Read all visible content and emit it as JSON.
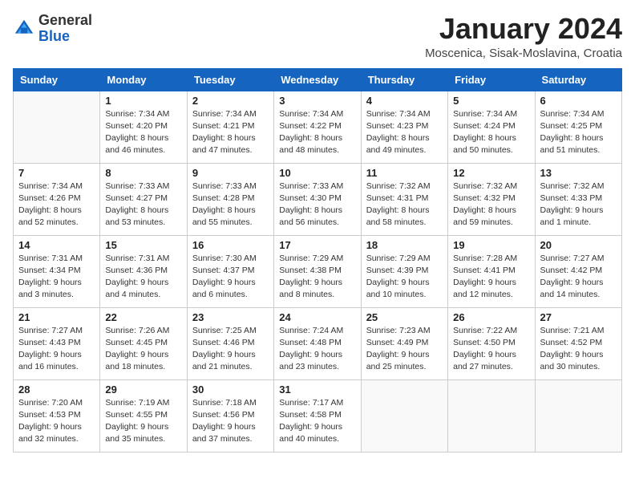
{
  "header": {
    "logo_general": "General",
    "logo_blue": "Blue",
    "month_title": "January 2024",
    "location": "Moscenica, Sisak-Moslavina, Croatia"
  },
  "days_of_week": [
    "Sunday",
    "Monday",
    "Tuesday",
    "Wednesday",
    "Thursday",
    "Friday",
    "Saturday"
  ],
  "weeks": [
    [
      {
        "day": "",
        "sunrise": "",
        "sunset": "",
        "daylight": "",
        "empty": true
      },
      {
        "day": "1",
        "sunrise": "Sunrise: 7:34 AM",
        "sunset": "Sunset: 4:20 PM",
        "daylight": "Daylight: 8 hours and 46 minutes."
      },
      {
        "day": "2",
        "sunrise": "Sunrise: 7:34 AM",
        "sunset": "Sunset: 4:21 PM",
        "daylight": "Daylight: 8 hours and 47 minutes."
      },
      {
        "day": "3",
        "sunrise": "Sunrise: 7:34 AM",
        "sunset": "Sunset: 4:22 PM",
        "daylight": "Daylight: 8 hours and 48 minutes."
      },
      {
        "day": "4",
        "sunrise": "Sunrise: 7:34 AM",
        "sunset": "Sunset: 4:23 PM",
        "daylight": "Daylight: 8 hours and 49 minutes."
      },
      {
        "day": "5",
        "sunrise": "Sunrise: 7:34 AM",
        "sunset": "Sunset: 4:24 PM",
        "daylight": "Daylight: 8 hours and 50 minutes."
      },
      {
        "day": "6",
        "sunrise": "Sunrise: 7:34 AM",
        "sunset": "Sunset: 4:25 PM",
        "daylight": "Daylight: 8 hours and 51 minutes."
      }
    ],
    [
      {
        "day": "7",
        "sunrise": "Sunrise: 7:34 AM",
        "sunset": "Sunset: 4:26 PM",
        "daylight": "Daylight: 8 hours and 52 minutes."
      },
      {
        "day": "8",
        "sunrise": "Sunrise: 7:33 AM",
        "sunset": "Sunset: 4:27 PM",
        "daylight": "Daylight: 8 hours and 53 minutes."
      },
      {
        "day": "9",
        "sunrise": "Sunrise: 7:33 AM",
        "sunset": "Sunset: 4:28 PM",
        "daylight": "Daylight: 8 hours and 55 minutes."
      },
      {
        "day": "10",
        "sunrise": "Sunrise: 7:33 AM",
        "sunset": "Sunset: 4:30 PM",
        "daylight": "Daylight: 8 hours and 56 minutes."
      },
      {
        "day": "11",
        "sunrise": "Sunrise: 7:32 AM",
        "sunset": "Sunset: 4:31 PM",
        "daylight": "Daylight: 8 hours and 58 minutes."
      },
      {
        "day": "12",
        "sunrise": "Sunrise: 7:32 AM",
        "sunset": "Sunset: 4:32 PM",
        "daylight": "Daylight: 8 hours and 59 minutes."
      },
      {
        "day": "13",
        "sunrise": "Sunrise: 7:32 AM",
        "sunset": "Sunset: 4:33 PM",
        "daylight": "Daylight: 9 hours and 1 minute."
      }
    ],
    [
      {
        "day": "14",
        "sunrise": "Sunrise: 7:31 AM",
        "sunset": "Sunset: 4:34 PM",
        "daylight": "Daylight: 9 hours and 3 minutes."
      },
      {
        "day": "15",
        "sunrise": "Sunrise: 7:31 AM",
        "sunset": "Sunset: 4:36 PM",
        "daylight": "Daylight: 9 hours and 4 minutes."
      },
      {
        "day": "16",
        "sunrise": "Sunrise: 7:30 AM",
        "sunset": "Sunset: 4:37 PM",
        "daylight": "Daylight: 9 hours and 6 minutes."
      },
      {
        "day": "17",
        "sunrise": "Sunrise: 7:29 AM",
        "sunset": "Sunset: 4:38 PM",
        "daylight": "Daylight: 9 hours and 8 minutes."
      },
      {
        "day": "18",
        "sunrise": "Sunrise: 7:29 AM",
        "sunset": "Sunset: 4:39 PM",
        "daylight": "Daylight: 9 hours and 10 minutes."
      },
      {
        "day": "19",
        "sunrise": "Sunrise: 7:28 AM",
        "sunset": "Sunset: 4:41 PM",
        "daylight": "Daylight: 9 hours and 12 minutes."
      },
      {
        "day": "20",
        "sunrise": "Sunrise: 7:27 AM",
        "sunset": "Sunset: 4:42 PM",
        "daylight": "Daylight: 9 hours and 14 minutes."
      }
    ],
    [
      {
        "day": "21",
        "sunrise": "Sunrise: 7:27 AM",
        "sunset": "Sunset: 4:43 PM",
        "daylight": "Daylight: 9 hours and 16 minutes."
      },
      {
        "day": "22",
        "sunrise": "Sunrise: 7:26 AM",
        "sunset": "Sunset: 4:45 PM",
        "daylight": "Daylight: 9 hours and 18 minutes."
      },
      {
        "day": "23",
        "sunrise": "Sunrise: 7:25 AM",
        "sunset": "Sunset: 4:46 PM",
        "daylight": "Daylight: 9 hours and 21 minutes."
      },
      {
        "day": "24",
        "sunrise": "Sunrise: 7:24 AM",
        "sunset": "Sunset: 4:48 PM",
        "daylight": "Daylight: 9 hours and 23 minutes."
      },
      {
        "day": "25",
        "sunrise": "Sunrise: 7:23 AM",
        "sunset": "Sunset: 4:49 PM",
        "daylight": "Daylight: 9 hours and 25 minutes."
      },
      {
        "day": "26",
        "sunrise": "Sunrise: 7:22 AM",
        "sunset": "Sunset: 4:50 PM",
        "daylight": "Daylight: 9 hours and 27 minutes."
      },
      {
        "day": "27",
        "sunrise": "Sunrise: 7:21 AM",
        "sunset": "Sunset: 4:52 PM",
        "daylight": "Daylight: 9 hours and 30 minutes."
      }
    ],
    [
      {
        "day": "28",
        "sunrise": "Sunrise: 7:20 AM",
        "sunset": "Sunset: 4:53 PM",
        "daylight": "Daylight: 9 hours and 32 minutes."
      },
      {
        "day": "29",
        "sunrise": "Sunrise: 7:19 AM",
        "sunset": "Sunset: 4:55 PM",
        "daylight": "Daylight: 9 hours and 35 minutes."
      },
      {
        "day": "30",
        "sunrise": "Sunrise: 7:18 AM",
        "sunset": "Sunset: 4:56 PM",
        "daylight": "Daylight: 9 hours and 37 minutes."
      },
      {
        "day": "31",
        "sunrise": "Sunrise: 7:17 AM",
        "sunset": "Sunset: 4:58 PM",
        "daylight": "Daylight: 9 hours and 40 minutes."
      },
      {
        "day": "",
        "sunrise": "",
        "sunset": "",
        "daylight": "",
        "empty": true
      },
      {
        "day": "",
        "sunrise": "",
        "sunset": "",
        "daylight": "",
        "empty": true
      },
      {
        "day": "",
        "sunrise": "",
        "sunset": "",
        "daylight": "",
        "empty": true
      }
    ]
  ]
}
